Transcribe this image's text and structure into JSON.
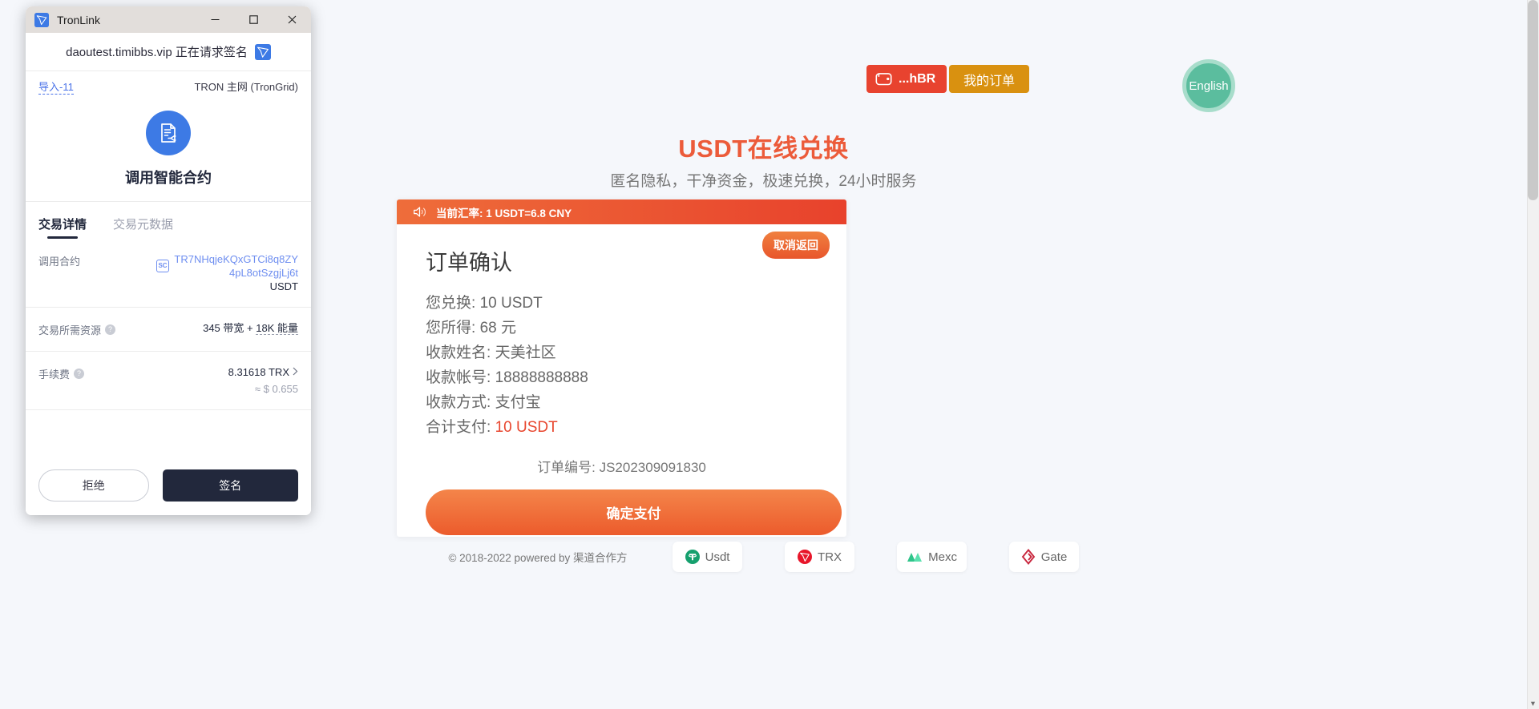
{
  "page": {
    "header": {
      "wallet_button_label": "...hBR",
      "wallet_icon": "wallet-icon",
      "my_orders_label": "我的订单",
      "language_label": "English"
    },
    "hero": {
      "title": "USDT在线兑换",
      "subtitle": "匿名隐私，干净资金，极速兑换，24小时服务"
    },
    "card": {
      "rate_icon": "speaker-icon",
      "rate_text": "当前汇率: 1 USDT=6.8 CNY",
      "title": "订单确认",
      "cancel_label": "取消返回",
      "details": [
        {
          "label": "您兑换:",
          "value": "10 USDT",
          "accent": false
        },
        {
          "label": "您所得:",
          "value": "68 元",
          "accent": false
        },
        {
          "label": "收款姓名:",
          "value": "天美社区",
          "accent": false
        },
        {
          "label": "收款帐号:",
          "value": "18888888888",
          "accent": false
        },
        {
          "label": "收款方式:",
          "value": "支付宝",
          "accent": false
        },
        {
          "label": "合计支付:",
          "value": "10 USDT",
          "accent": true
        }
      ],
      "order_label": "订单编号:",
      "order_number": "JS202309091830",
      "pay_button_label": "确定支付"
    },
    "footer": {
      "copyright": "© 2018-2022 powered by 渠道合作方",
      "partners": [
        {
          "name": "Usdt",
          "icon": "usdt-icon",
          "color": "#15a06e"
        },
        {
          "name": "TRX",
          "icon": "trx-icon",
          "color": "#e8162a"
        },
        {
          "name": "Mexc",
          "icon": "mexc-icon",
          "color": "#38d39f"
        },
        {
          "name": "Gate",
          "icon": "gate-icon",
          "color": "#c8253c"
        }
      ]
    },
    "colors": {
      "brand_red": "#e8432f",
      "brand_orange": "#ec5b2c",
      "order_gold": "#d99110",
      "lang_green": "#5bbd9e"
    }
  },
  "tronlink": {
    "window": {
      "title": "TronLink",
      "logo_icon": "tronlink-logo-icon",
      "minimize_icon": "minimize-icon",
      "maximize_icon": "maximize-icon",
      "close_icon": "close-icon"
    },
    "request": {
      "domain_text": "daoutest.timibbs.vip 正在请求签名",
      "badge_icon": "tronlink-badge-icon"
    },
    "account": {
      "name": "导入-11",
      "network": "TRON 主网 (TronGrid)"
    },
    "action": {
      "icon": "smart-contract-icon",
      "title": "调用智能合约"
    },
    "tabs": [
      {
        "label": "交易详情",
        "active": true
      },
      {
        "label": "交易元数据",
        "active": false
      }
    ],
    "fields": {
      "contract_label": "调用合约",
      "contract_badge": "SC",
      "contract_address": "TR7NHqjeKQxGTCi8q8ZY4pL8otSzgjLj6t",
      "contract_symbol": "USDT",
      "resource_label": "交易所需资源",
      "resource_bandwidth": "345 带宽",
      "resource_plus": "+",
      "resource_energy": "18K 能量",
      "fee_label": "手续费",
      "fee_value": "8.31618 TRX",
      "fee_chevron": "chevron-right-icon",
      "fee_usd": "≈ $ 0.655"
    },
    "buttons": {
      "reject_label": "拒绝",
      "sign_label": "签名"
    }
  }
}
